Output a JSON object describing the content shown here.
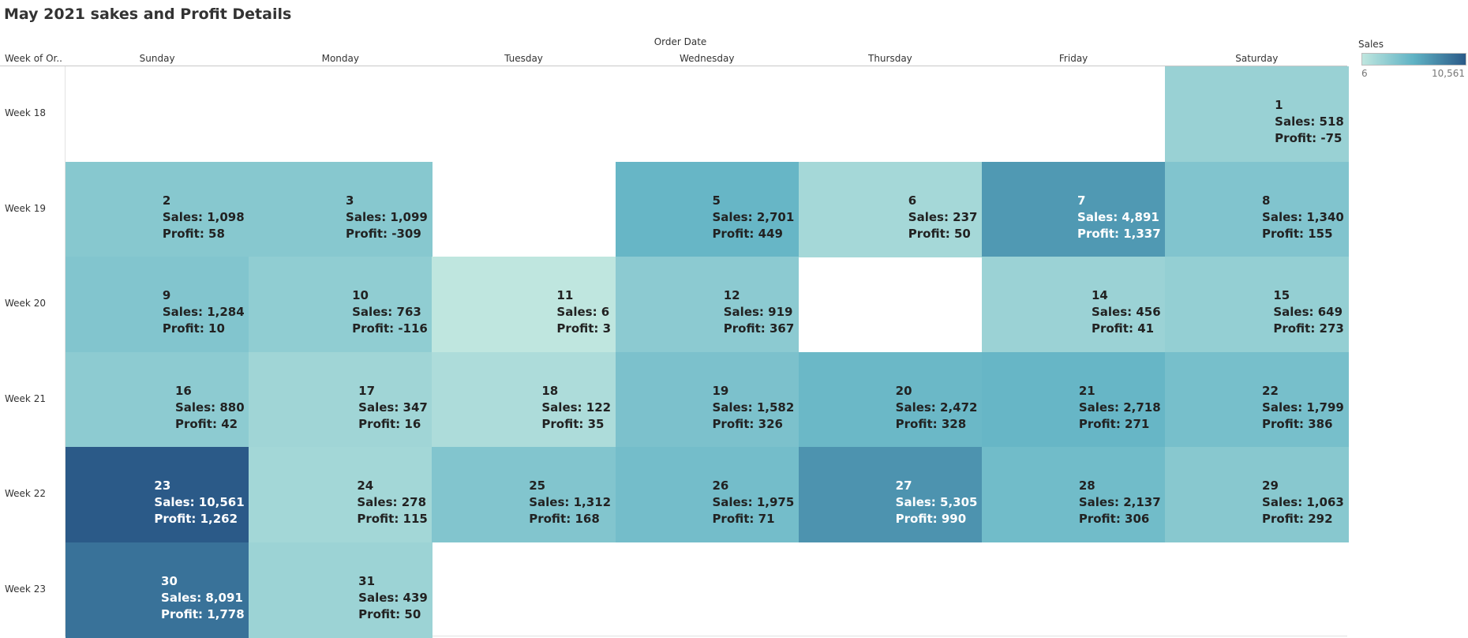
{
  "title": "May 2021 sakes and Profit Details",
  "column_group_label": "Order Date",
  "row_header_label": "Week of Or..",
  "legend": {
    "title": "Sales",
    "min_label": "6",
    "max_label": "10,561",
    "min_value": 6,
    "max_value": 10561,
    "color_low": "#bfe6df",
    "color_mid": "#5fb2c4",
    "color_high": "#2b5a88"
  },
  "chart_data": {
    "type": "heatmap",
    "title": "May 2021 sakes and Profit Details",
    "x_label": "Order Date",
    "y_label": "Week of Or..",
    "columns": [
      "Sunday",
      "Monday",
      "Tuesday",
      "Wednesday",
      "Thursday",
      "Friday",
      "Saturday"
    ],
    "rows": [
      "Week 18",
      "Week 19",
      "Week 20",
      "Week 21",
      "Week 22",
      "Week 23"
    ],
    "color_measure": "Sales",
    "color_range": [
      6,
      10561
    ],
    "cells": [
      {
        "day": "1",
        "row": 0,
        "col": 6,
        "sales": 518,
        "profit": -75,
        "sales_label": "Sales: 518",
        "profit_label": "Profit: -75"
      },
      {
        "day": "2",
        "row": 1,
        "col": 0,
        "sales": 1098,
        "profit": 58,
        "sales_label": "Sales: 1,098",
        "profit_label": "Profit: 58"
      },
      {
        "day": "3",
        "row": 1,
        "col": 1,
        "sales": 1099,
        "profit": -309,
        "sales_label": "Sales: 1,099",
        "profit_label": "Profit: -309"
      },
      {
        "day": "5",
        "row": 1,
        "col": 3,
        "sales": 2701,
        "profit": 449,
        "sales_label": "Sales: 2,701",
        "profit_label": "Profit: 449"
      },
      {
        "day": "6",
        "row": 1,
        "col": 4,
        "sales": 237,
        "profit": 50,
        "sales_label": "Sales: 237",
        "profit_label": "Profit: 50"
      },
      {
        "day": "7",
        "row": 1,
        "col": 5,
        "sales": 4891,
        "profit": 1337,
        "sales_label": "Sales: 4,891",
        "profit_label": "Profit: 1,337"
      },
      {
        "day": "8",
        "row": 1,
        "col": 6,
        "sales": 1340,
        "profit": 155,
        "sales_label": "Sales: 1,340",
        "profit_label": "Profit: 155"
      },
      {
        "day": "9",
        "row": 2,
        "col": 0,
        "sales": 1284,
        "profit": 10,
        "sales_label": "Sales: 1,284",
        "profit_label": "Profit: 10"
      },
      {
        "day": "10",
        "row": 2,
        "col": 1,
        "sales": 763,
        "profit": -116,
        "sales_label": "Sales: 763",
        "profit_label": "Profit: -116"
      },
      {
        "day": "11",
        "row": 2,
        "col": 2,
        "sales": 6,
        "profit": 3,
        "sales_label": "Sales: 6",
        "profit_label": "Profit: 3"
      },
      {
        "day": "12",
        "row": 2,
        "col": 3,
        "sales": 919,
        "profit": 367,
        "sales_label": "Sales: 919",
        "profit_label": "Profit: 367"
      },
      {
        "day": "14",
        "row": 2,
        "col": 5,
        "sales": 456,
        "profit": 41,
        "sales_label": "Sales: 456",
        "profit_label": "Profit: 41"
      },
      {
        "day": "15",
        "row": 2,
        "col": 6,
        "sales": 649,
        "profit": 273,
        "sales_label": "Sales: 649",
        "profit_label": "Profit: 273"
      },
      {
        "day": "16",
        "row": 3,
        "col": 0,
        "sales": 880,
        "profit": 42,
        "sales_label": "Sales: 880",
        "profit_label": "Profit: 42"
      },
      {
        "day": "17",
        "row": 3,
        "col": 1,
        "sales": 347,
        "profit": 16,
        "sales_label": "Sales: 347",
        "profit_label": "Profit: 16"
      },
      {
        "day": "18",
        "row": 3,
        "col": 2,
        "sales": 122,
        "profit": 35,
        "sales_label": "Sales: 122",
        "profit_label": "Profit: 35"
      },
      {
        "day": "19",
        "row": 3,
        "col": 3,
        "sales": 1582,
        "profit": 326,
        "sales_label": "Sales: 1,582",
        "profit_label": "Profit: 326"
      },
      {
        "day": "20",
        "row": 3,
        "col": 4,
        "sales": 2472,
        "profit": 328,
        "sales_label": "Sales: 2,472",
        "profit_label": "Profit: 328"
      },
      {
        "day": "21",
        "row": 3,
        "col": 5,
        "sales": 2718,
        "profit": 271,
        "sales_label": "Sales: 2,718",
        "profit_label": "Profit: 271"
      },
      {
        "day": "22",
        "row": 3,
        "col": 6,
        "sales": 1799,
        "profit": 386,
        "sales_label": "Sales: 1,799",
        "profit_label": "Profit: 386"
      },
      {
        "day": "23",
        "row": 4,
        "col": 0,
        "sales": 10561,
        "profit": 1262,
        "sales_label": "Sales: 10,561",
        "profit_label": "Profit: 1,262"
      },
      {
        "day": "24",
        "row": 4,
        "col": 1,
        "sales": 278,
        "profit": 115,
        "sales_label": "Sales: 278",
        "profit_label": "Profit: 115"
      },
      {
        "day": "25",
        "row": 4,
        "col": 2,
        "sales": 1312,
        "profit": 168,
        "sales_label": "Sales: 1,312",
        "profit_label": "Profit: 168"
      },
      {
        "day": "26",
        "row": 4,
        "col": 3,
        "sales": 1975,
        "profit": 71,
        "sales_label": "Sales: 1,975",
        "profit_label": "Profit: 71"
      },
      {
        "day": "27",
        "row": 4,
        "col": 4,
        "sales": 5305,
        "profit": 990,
        "sales_label": "Sales: 5,305",
        "profit_label": "Profit: 990"
      },
      {
        "day": "28",
        "row": 4,
        "col": 5,
        "sales": 2137,
        "profit": 306,
        "sales_label": "Sales: 2,137",
        "profit_label": "Profit: 306"
      },
      {
        "day": "29",
        "row": 4,
        "col": 6,
        "sales": 1063,
        "profit": 292,
        "sales_label": "Sales: 1,063",
        "profit_label": "Profit: 292"
      },
      {
        "day": "30",
        "row": 5,
        "col": 0,
        "sales": 8091,
        "profit": 1778,
        "sales_label": "Sales: 8,091",
        "profit_label": "Profit: 1,778"
      },
      {
        "day": "31",
        "row": 5,
        "col": 1,
        "sales": 439,
        "profit": 50,
        "sales_label": "Sales: 439",
        "profit_label": "Profit: 50"
      }
    ]
  }
}
